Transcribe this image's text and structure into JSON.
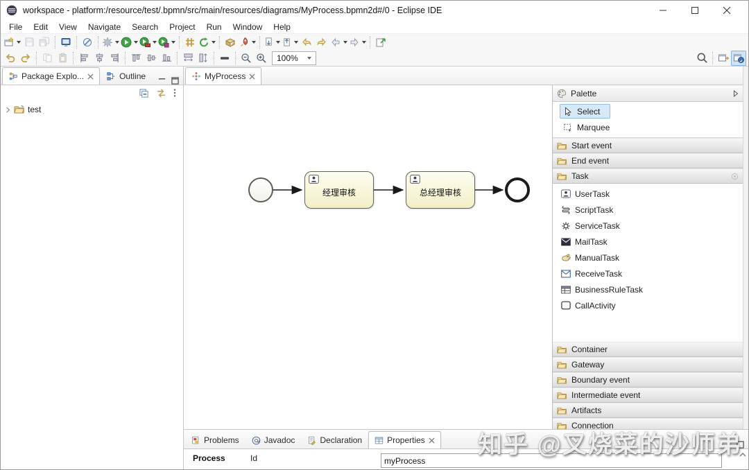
{
  "window": {
    "title": "workspace - platform:/resource/test/.bpmn/src/main/resources/diagrams/MyProcess.bpmn2d#/0 - Eclipse IDE"
  },
  "menu": {
    "items": [
      "File",
      "Edit",
      "View",
      "Navigate",
      "Search",
      "Project",
      "Run",
      "Window",
      "Help"
    ]
  },
  "toolbar": {
    "zoom_level": "100%"
  },
  "left_panel": {
    "tabs": [
      {
        "label": "Package Explo..."
      },
      {
        "label": "Outline"
      }
    ],
    "tree_items": [
      {
        "label": "test"
      }
    ]
  },
  "editor": {
    "tab_label": "MyProcess",
    "diagram": {
      "nodes": [
        {
          "type": "start-event"
        },
        {
          "type": "user-task",
          "label": "经理审核"
        },
        {
          "type": "user-task",
          "label": "总经理审核"
        },
        {
          "type": "end-event"
        }
      ],
      "flows": [
        {
          "from": 0,
          "to": 1
        },
        {
          "from": 1,
          "to": 2
        },
        {
          "from": 2,
          "to": 3
        }
      ]
    }
  },
  "palette": {
    "title": "Palette",
    "tools": [
      {
        "label": "Select",
        "selected": true
      },
      {
        "label": "Marquee",
        "selected": false
      }
    ],
    "drawers": [
      "Start event",
      "End event",
      "Task",
      "Container",
      "Gateway",
      "Boundary event",
      "Intermediate event",
      "Artifacts",
      "Connection"
    ],
    "task_items": [
      "UserTask",
      "ScriptTask",
      "ServiceTask",
      "MailTask",
      "ManualTask",
      "ReceiveTask",
      "BusinessRuleTask",
      "CallActivity"
    ]
  },
  "bottom_panel": {
    "tabs": [
      "Problems",
      "Javadoc",
      "Declaration",
      "Properties"
    ],
    "properties": {
      "section_label": "Process",
      "id_label": "Id",
      "id_value": "myProcess"
    }
  },
  "watermark": "知乎 @叉烧菜的沙师弟",
  "colors": {
    "selection_blue": "#d7e9f9",
    "task_fill": "#f2efc6",
    "task_border": "#63635a",
    "run_green": "#3fa544",
    "drawer_gray": "#dcdcdc"
  },
  "icons": [
    "eclipse-logo",
    "minimize",
    "maximize",
    "close",
    "new-wizard",
    "save",
    "save-all",
    "console",
    "skip-breakpoints",
    "debug",
    "run",
    "coverage",
    "profile",
    "new-java-project",
    "refresh",
    "open-type",
    "launch-rocket",
    "next-annotation",
    "prev-annotation",
    "back-history",
    "forward-history",
    "back",
    "forward",
    "link-with-editor",
    "undo",
    "redo",
    "copy",
    "paste",
    "align-left",
    "align-center",
    "align-right",
    "align-top",
    "align-middle",
    "align-bottom",
    "match-width",
    "match-height",
    "line-style",
    "zoom-out",
    "zoom-in",
    "search",
    "open-perspective",
    "java-perspective",
    "package-explorer",
    "outline",
    "collapse-all",
    "link-editor",
    "view-menu",
    "chevron-right",
    "folder-open",
    "diagram",
    "palette",
    "select-cursor",
    "marquee",
    "user",
    "script",
    "gear",
    "mail-filled",
    "hand",
    "mail-outline",
    "grid",
    "rounded-rect",
    "pin",
    "problems",
    "javadoc",
    "declaration",
    "properties",
    "collapse-chevron"
  ]
}
